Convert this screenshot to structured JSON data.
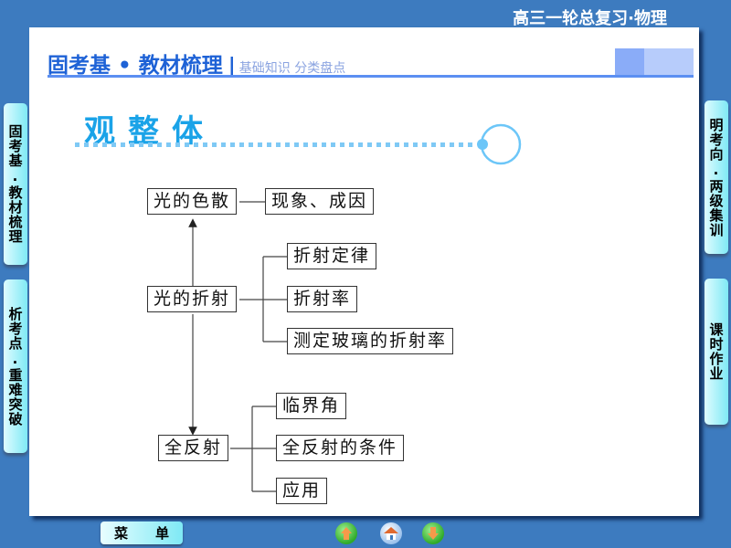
{
  "course_title": "高三一轮总复习·物理",
  "section_header": {
    "main": "固考基 • 教材梳理",
    "separator": "|",
    "sub": "基础知识  分类盘点"
  },
  "overview_title": "观整体",
  "side_tabs": {
    "left": [
      {
        "label": "固考基.教材梳理"
      },
      {
        "label": "析考点.重难突破"
      }
    ],
    "right": [
      {
        "label": "明考向.两级集训"
      },
      {
        "label": "课时作业"
      }
    ]
  },
  "diagram": {
    "nodes": {
      "dispersion": "光的色散",
      "dispersion_detail": "现象、成因",
      "refraction": "光的折射",
      "refraction_law": "折射定律",
      "refractive_index": "折射率",
      "measure_glass": "测定玻璃的折射率",
      "total_reflection": "全反射",
      "critical_angle": "临界角",
      "tir_condition": "全反射的条件",
      "application": "应用"
    }
  },
  "bottom_nav": {
    "menu_label_1": "菜",
    "menu_label_2": "单",
    "prev_icon": "arrow-up-icon",
    "home_icon": "home-icon",
    "next_icon": "arrow-down-icon"
  },
  "colors": {
    "background": "#3d7bbf",
    "header_blue": "#1e62d6",
    "overview_cyan": "#1aa3e8",
    "tab_cyan": "#7fe9f5"
  }
}
